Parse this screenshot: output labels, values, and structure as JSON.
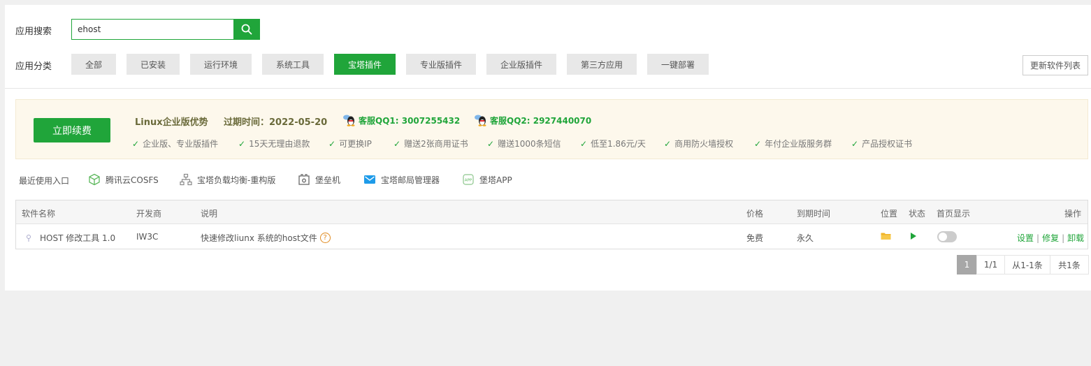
{
  "search": {
    "label": "应用搜索",
    "value": "ehost"
  },
  "category": {
    "label": "应用分类",
    "buttons": [
      "全部",
      "已安装",
      "运行环境",
      "系统工具",
      "宝塔插件",
      "专业版插件",
      "企业版插件",
      "第三方应用",
      "一键部署"
    ],
    "active": "宝塔插件"
  },
  "refresh_label": "更新软件列表",
  "promo": {
    "renew_label": "立即续费",
    "title": "Linux企业版优势",
    "expire_label": "过期时间：",
    "expire_date": "2022-05-20",
    "qq1": "客服QQ1: 3007255432",
    "qq2": "客服QQ2: 2927440070",
    "features": [
      "企业版、专业版插件",
      "15天无理由退款",
      "可更换IP",
      "赠送2张商用证书",
      "赠送1000条短信",
      "低至1.86元/天",
      "商用防火墙授权",
      "年付企业版服务群",
      "产品授权证书"
    ]
  },
  "recent": {
    "label": "最近使用入口",
    "items": [
      {
        "label": "腾讯云COSFS",
        "icon": "cube-icon"
      },
      {
        "label": "宝塔负载均衡-重构版",
        "icon": "network-icon"
      },
      {
        "label": "堡垒机",
        "icon": "bastion-icon"
      },
      {
        "label": "宝塔邮局管理器",
        "icon": "mail-icon"
      },
      {
        "label": "堡塔APP",
        "icon": "app-icon"
      }
    ]
  },
  "table": {
    "headers": [
      "软件名称",
      "开发商",
      "说明",
      "价格",
      "到期时间",
      "位置",
      "状态",
      "首页显示",
      "操作"
    ],
    "rows": [
      {
        "name": "HOST 修改工具 1.0",
        "developer": "IW3C",
        "desc": "快速修改liunx 系统的host文件",
        "price": "免费",
        "expire": "永久",
        "actions": [
          "设置",
          "修复",
          "卸载"
        ]
      }
    ]
  },
  "pager": {
    "current": "1",
    "pages": "1/1",
    "range": "从1-1条",
    "total": "共1条"
  },
  "colors": {
    "accent": "#20a53a",
    "promo_bg": "#fdf8ec",
    "folder": "#f0b429"
  }
}
